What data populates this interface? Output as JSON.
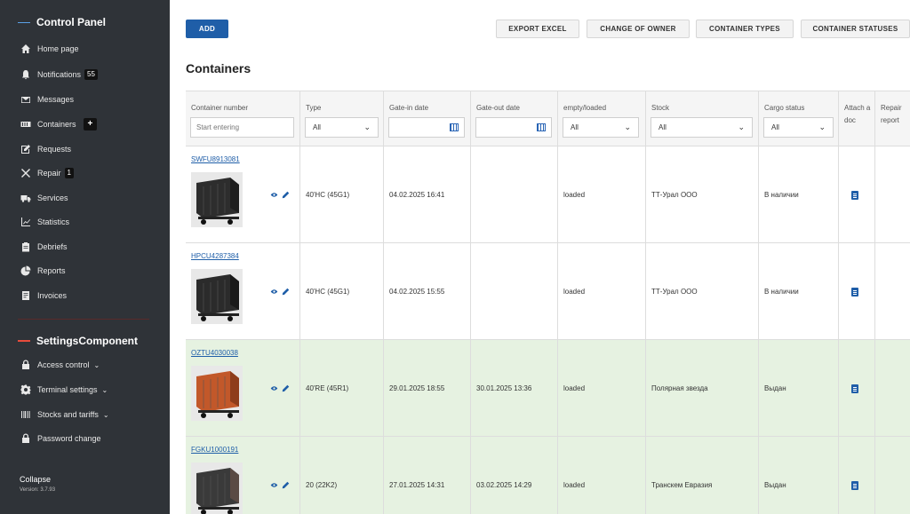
{
  "sidebar": {
    "title": "Control Panel",
    "items": [
      {
        "label": "Home page",
        "icon": "home-icon"
      },
      {
        "label": "Notifications",
        "icon": "bell-icon",
        "badge": "55"
      },
      {
        "label": "Messages",
        "icon": "envelope-icon"
      },
      {
        "label": "Containers",
        "icon": "container-icon",
        "badge": "+"
      },
      {
        "label": "Requests",
        "icon": "edit-icon"
      },
      {
        "label": "Repair",
        "icon": "tools-icon",
        "badge": "1"
      },
      {
        "label": "Services",
        "icon": "truck-icon"
      },
      {
        "label": "Statistics",
        "icon": "chart-icon"
      },
      {
        "label": "Debriefs",
        "icon": "clipboard-icon"
      },
      {
        "label": "Reports",
        "icon": "pie-icon"
      },
      {
        "label": "Invoices",
        "icon": "invoice-icon"
      }
    ],
    "settings_title": "SettingsComponent",
    "settings_items": [
      {
        "label": "Access control",
        "icon": "lock-icon",
        "chevron": "⌄"
      },
      {
        "label": "Terminal settings",
        "icon": "gear-icon",
        "chevron": "⌄"
      },
      {
        "label": "Stocks and tariffs",
        "icon": "barcode-icon",
        "chevron": "⌄"
      },
      {
        "label": "Password change",
        "icon": "lock-icon"
      }
    ],
    "collapse": "Collapse",
    "version": "Version: 3.7.93"
  },
  "toolbar": {
    "add": "ADD",
    "export_excel": "EXPORT EXCEL",
    "change_owner": "CHANGE OF OWNER",
    "container_types": "CONTAINER TYPES",
    "container_statuses": "CONTAINER STATUSES"
  },
  "page_title": "Containers",
  "table": {
    "headers": {
      "number": "Container number",
      "type": "Type",
      "gate_in": "Gate-in date",
      "gate_out": "Gate-out date",
      "empty_loaded": "empty/loaded",
      "stock": "Stock",
      "cargo_status": "Cargo status",
      "attach": "Attach a doc",
      "repair": "Repair report"
    },
    "filters": {
      "number_placeholder": "Start entering",
      "type": "All",
      "empty_loaded": "All",
      "stock": "All",
      "cargo_status": "All"
    },
    "rows": [
      {
        "number": "SWFU8913081",
        "type": "40'HC (45G1)",
        "gate_in": "04.02.2025 16:41",
        "gate_out": "",
        "state": "loaded",
        "stock": "ТТ-Урал ООО",
        "cargo": "В наличии",
        "highlight": false
      },
      {
        "number": "HPCU4287384",
        "type": "40'HC (45G1)",
        "gate_in": "04.02.2025 15:55",
        "gate_out": "",
        "state": "loaded",
        "stock": "ТТ-Урал ООО",
        "cargo": "В наличии",
        "highlight": false
      },
      {
        "number": "OZTU4030038",
        "type": "40'RE (45R1)",
        "gate_in": "29.01.2025 18:55",
        "gate_out": "30.01.2025 13:36",
        "state": "loaded",
        "stock": "Полярная звезда",
        "cargo": "Выдан",
        "highlight": true
      },
      {
        "number": "FGKU1000191",
        "type": "20 (22K2)",
        "gate_in": "27.01.2025 14:31",
        "gate_out": "03.02.2025 14:29",
        "state": "loaded",
        "stock": "Транскем Евразия",
        "cargo": "Выдан",
        "highlight": true
      }
    ]
  },
  "colors": {
    "sidebar_bg": "#2f3338",
    "primary": "#1f5ea8",
    "row_highlight": "#e6f2e1"
  }
}
